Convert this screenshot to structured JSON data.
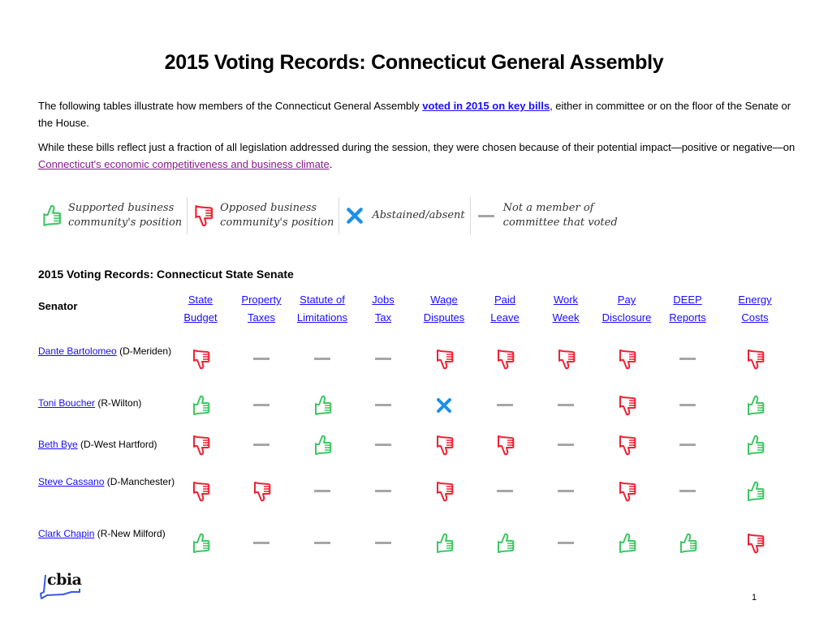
{
  "title": "2015 Voting Records: Connecticut General Assembly",
  "intro": {
    "p1_before": "The following tables illustrate how members of the Connecticut General Assembly ",
    "p1_link": "voted in 2015 on key bills",
    "p1_after": ", either in committee or on the floor of the Senate or the House.",
    "p2_before": "While these bills reflect just a fraction of all legislation addressed during the session, they were chosen because of their potential impact—positive or negative—on ",
    "p2_link": "Connecticut's economic competitiveness and business climate",
    "p2_after": "."
  },
  "legend": [
    {
      "icon": "thumbs-up-icon",
      "line1": "Supported business",
      "line2": "community's position"
    },
    {
      "icon": "thumbs-down-icon",
      "line1": "Opposed business",
      "line2": "community's position"
    },
    {
      "icon": "x-icon",
      "line1": "Abstained/absent",
      "line2": ""
    },
    {
      "icon": "dash-icon",
      "line1": "Not a member of",
      "line2": "committee that voted"
    }
  ],
  "colors": {
    "supported": "#3cc864",
    "opposed": "#ee2233",
    "abstained": "#1e8fe8",
    "not_member": "#a6a6a6",
    "link": "#1a0dff",
    "visited_link": "#8a1a8a"
  },
  "section": {
    "title": "2015 Voting Records: Connecticut State Senate",
    "senator_header": "Senator",
    "columns": [
      {
        "line1": "State",
        "line2": "Budget"
      },
      {
        "line1": "Property",
        "line2": "Taxes"
      },
      {
        "line1": "Statute of",
        "line2": "Limitations"
      },
      {
        "line1": "Jobs",
        "line2": "Tax"
      },
      {
        "line1": "Wage",
        "line2": "Disputes"
      },
      {
        "line1": "Paid",
        "line2": "Leave"
      },
      {
        "line1": "Work",
        "line2": "Week"
      },
      {
        "line1": "Pay",
        "line2": "Disclosure"
      },
      {
        "line1": "DEEP",
        "line2": "Reports"
      },
      {
        "line1": "Energy",
        "line2": "Costs"
      }
    ],
    "rows": [
      {
        "name": "Dante Bartolomeo",
        "district": " (D-Meriden)",
        "votes": [
          "opposed",
          "none",
          "none",
          "none",
          "opposed",
          "opposed",
          "opposed",
          "opposed",
          "none",
          "opposed"
        ]
      },
      {
        "name": "Toni Boucher",
        "district": " (R-Wilton)",
        "votes": [
          "supported",
          "none",
          "supported",
          "none",
          "abstained",
          "none",
          "none",
          "opposed",
          "none",
          "supported"
        ]
      },
      {
        "name": "Beth Bye",
        "district": " (D-West Hartford)",
        "votes": [
          "opposed",
          "none",
          "supported",
          "none",
          "opposed",
          "opposed",
          "none",
          "opposed",
          "none",
          "supported"
        ]
      },
      {
        "name": "Steve Cassano",
        "district": " (D-Manchester)",
        "votes": [
          "opposed",
          "opposed",
          "none",
          "none",
          "opposed",
          "none",
          "none",
          "opposed",
          "none",
          "supported"
        ]
      },
      {
        "name": "Clark Chapin",
        "district": " (R-New Milford)",
        "votes": [
          "supported",
          "none",
          "none",
          "none",
          "supported",
          "supported",
          "none",
          "supported",
          "supported",
          "opposed"
        ]
      }
    ]
  },
  "footer": {
    "logo_text": "cbia",
    "page_number": "1"
  }
}
